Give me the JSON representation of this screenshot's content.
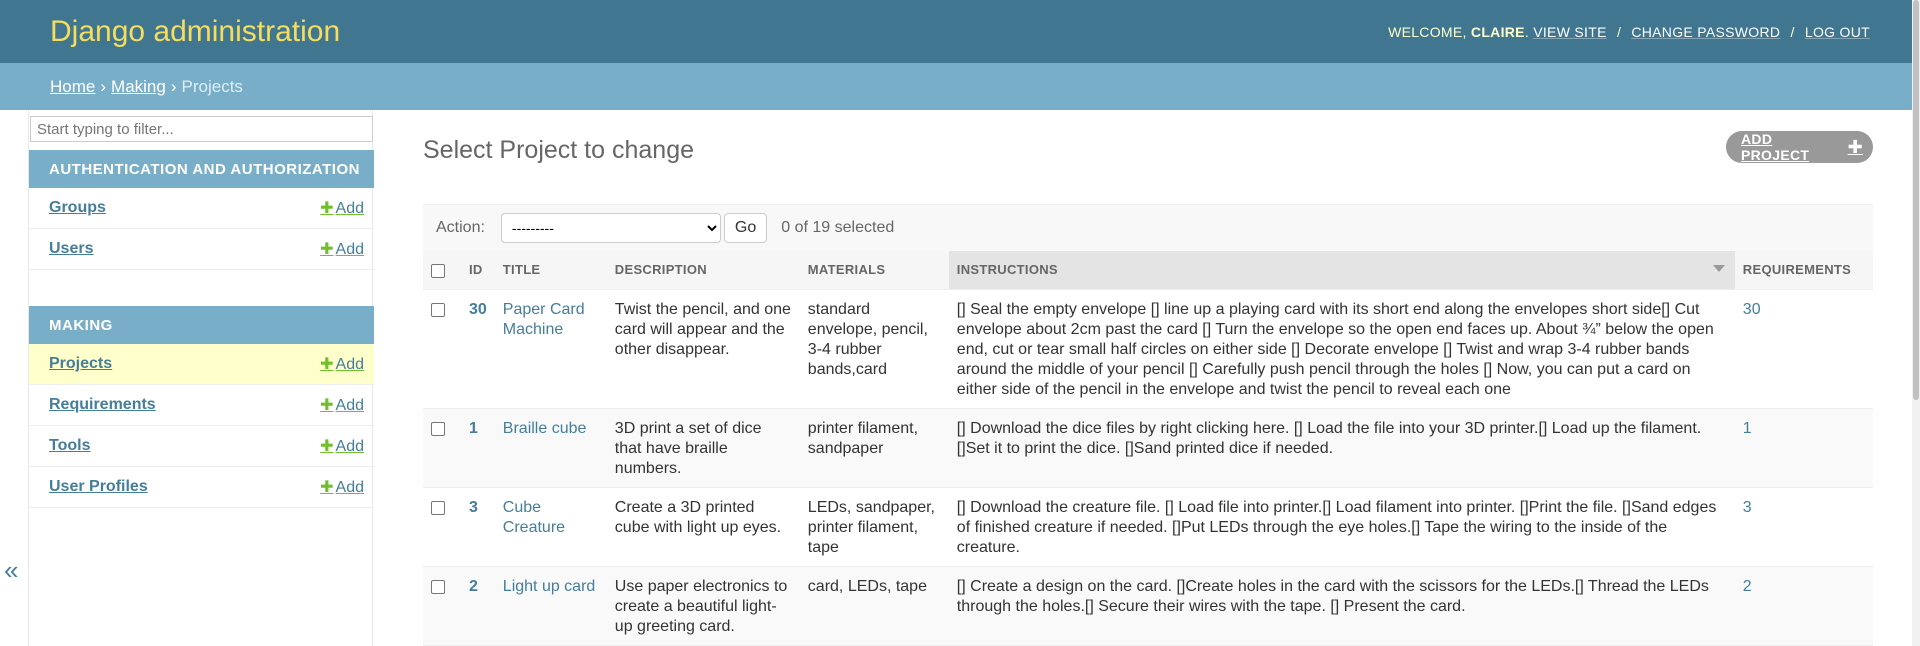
{
  "header": {
    "branding": "Django administration",
    "welcome": "WELCOME,",
    "username": "CLAIRE",
    "view_site": "VIEW SITE",
    "change_password": "CHANGE PASSWORD",
    "log_out": "LOG OUT",
    "separator": "/"
  },
  "breadcrumbs": {
    "home": "Home",
    "app": "Making",
    "current": "Projects",
    "separator": "›"
  },
  "sidebar": {
    "filter_placeholder": "Start typing to filter...",
    "add_label": "Add",
    "auth_caption": "AUTHENTICATION AND AUTHORIZATION",
    "auth_models": [
      "Groups",
      "Users"
    ],
    "making_caption": "MAKING",
    "making_models": [
      "Projects",
      "Requirements",
      "Tools",
      "User Profiles"
    ],
    "collapse_glyph": "«"
  },
  "content": {
    "title": "Select Project to change",
    "add_button": "ADD PROJECT",
    "action_label": "Action:",
    "action_selected": "---------",
    "go_button": "Go",
    "counter": "0 of 19 selected"
  },
  "table": {
    "columns": [
      "ID",
      "TITLE",
      "DESCRIPTION",
      "MATERIALS",
      "INSTRUCTIONS",
      "REQUIREMENTS"
    ],
    "rows": [
      {
        "id": "30",
        "title": "Paper Card Machine",
        "description": "Twist the pencil, and one card will appear and the other disappear.",
        "materials": "standard envelope, pencil, 3-4 rubber bands,card",
        "instructions": "[] Seal the empty envelope [] line up a playing card with its short end along the envelopes short side[] Cut envelope about 2cm past the card [] Turn the envelope so the open end faces up. About ¾” below the open end, cut or tear small half circles on either side [] Decorate envelope [] Twist and wrap 3-4 rubber bands around the middle of your pencil [] Carefully push pencil through the holes [] Now, you can put a card on either side of the pencil in the envelope and twist the pencil to reveal each one",
        "requirements": "30"
      },
      {
        "id": "1",
        "title": "Braille cube",
        "description": "3D print a set of dice that have braille numbers.",
        "materials": "printer filament, sandpaper",
        "instructions": "[] Download the dice files by right clicking here. [] Load the file into your 3D printer.[] Load up the filament. []Set it to print the dice. []Sand printed dice if needed.",
        "requirements": "1"
      },
      {
        "id": "3",
        "title": "Cube Creature",
        "description": "Create a 3D printed cube with light up eyes.",
        "materials": "LEDs, sandpaper, printer filament, tape",
        "instructions": "[] Download the creature file. [] Load file into printer.[] Load filament into printer. []Print the file. []Sand edges of finished creature if needed. []Put LEDs through the eye holes.[] Tape the wiring to the inside of the creature.",
        "requirements": "3"
      },
      {
        "id": "2",
        "title": "Light up card",
        "description": "Use paper electronics to create a beautiful light-up greeting card.",
        "materials": "card, LEDs, tape",
        "instructions": "[] Create a design on the card. []Create holes in the card with the scissors for the LEDs.[] Thread the LEDs through the holes.[] Secure their wires with the tape. [] Present the card.",
        "requirements": "2"
      }
    ]
  },
  "colors": {
    "header_bg": "#417690",
    "branding": "#f5dd5d",
    "breadcrumbs_bg": "#79aec8",
    "link": "#447e9b",
    "add_green": "#70bf2b",
    "current_row_bg": "#ffffcc"
  }
}
